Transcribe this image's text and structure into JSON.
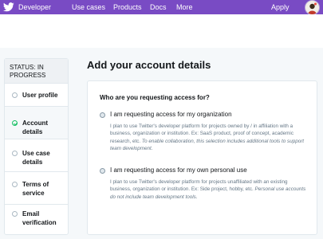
{
  "header": {
    "brand": "Developer",
    "nav": [
      "Use cases",
      "Products",
      "Docs",
      "More"
    ],
    "apply": "Apply"
  },
  "sidebar": {
    "status": "STATUS: IN PROGRESS",
    "steps": [
      {
        "label": "User profile",
        "state": "pending"
      },
      {
        "label": "Account details",
        "state": "done"
      },
      {
        "label": "Use case details",
        "state": "pending"
      },
      {
        "label": "Terms of service",
        "state": "pending"
      },
      {
        "label": "Email verification",
        "state": "pending"
      }
    ]
  },
  "main": {
    "title": "Add your account details",
    "question": "Who are you requesting access for?",
    "options": [
      {
        "label": "I am requesting access for my organization",
        "desc": "I plan to use Twitter's developer platform for projects owned by / in affiliation with a business, organization or institution. Ex: SaaS product, proof of concept, academic research, etc.",
        "note": "To enable collaboration, this selection includes additional tools to support team development."
      },
      {
        "label": "I am requesting access for my own personal use",
        "desc": "I plan to use Twitter's developer platform for projects unaffiliated with an existing business, organization or institution. Ex: Side project, hobby, etc.",
        "note": "Personal use accounts do not include team development tools."
      }
    ]
  },
  "colors": {
    "header_bg": "#794bc4",
    "check": "#17bf63"
  }
}
